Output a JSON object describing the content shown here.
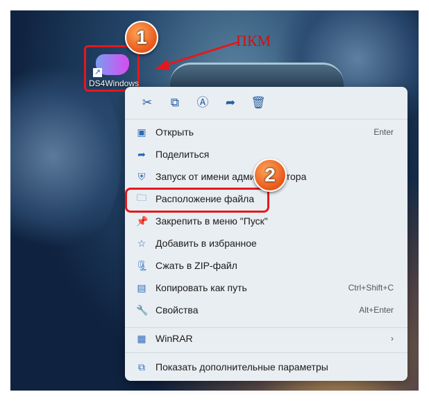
{
  "desktop_icon": {
    "label": "DS4Windows",
    "shortcut_icon": "shortcut-arrow-icon"
  },
  "annotations": {
    "step1": "1",
    "step2": "2",
    "right_click_label": "ПКМ"
  },
  "toolbar": [
    {
      "icon": "cut-icon",
      "g": "✂"
    },
    {
      "icon": "copy-icon",
      "g": "⧉"
    },
    {
      "icon": "rename-icon",
      "g": "Ⓐ"
    },
    {
      "icon": "share-icon",
      "g": "➦"
    },
    {
      "icon": "delete-icon",
      "g": "🗑"
    }
  ],
  "items": [
    {
      "label": "Открыть",
      "shortcut": "Enter",
      "icon": "open-icon",
      "g": "▣"
    },
    {
      "label": "Поделиться",
      "shortcut": "",
      "icon": "share-icon",
      "g": "➦"
    },
    {
      "label": "Запуск от имени администратора",
      "shortcut": "",
      "icon": "admin-shield-icon",
      "g": "⛨"
    },
    {
      "label": "Расположение файла",
      "shortcut": "",
      "icon": "folder-icon",
      "g": "🗀"
    },
    {
      "label": "Закрепить в меню \"Пуск\"",
      "shortcut": "",
      "icon": "pin-icon",
      "g": "📌"
    },
    {
      "label": "Добавить в избранное",
      "shortcut": "",
      "icon": "star-icon",
      "g": "☆"
    },
    {
      "label": "Сжать в ZIP-файл",
      "shortcut": "",
      "icon": "zip-icon",
      "g": "🗜"
    },
    {
      "label": "Копировать как путь",
      "shortcut": "Ctrl+Shift+C",
      "icon": "copy-path-icon",
      "g": "▤"
    },
    {
      "label": "Свойства",
      "shortcut": "Alt+Enter",
      "icon": "wrench-icon",
      "g": "🔧"
    },
    {
      "label": "WinRAR",
      "shortcut": "›",
      "icon": "winrar-icon",
      "g": "▦"
    },
    {
      "label": "Показать дополнительные параметры",
      "shortcut": "",
      "icon": "more-options-icon",
      "g": "⧉"
    }
  ]
}
